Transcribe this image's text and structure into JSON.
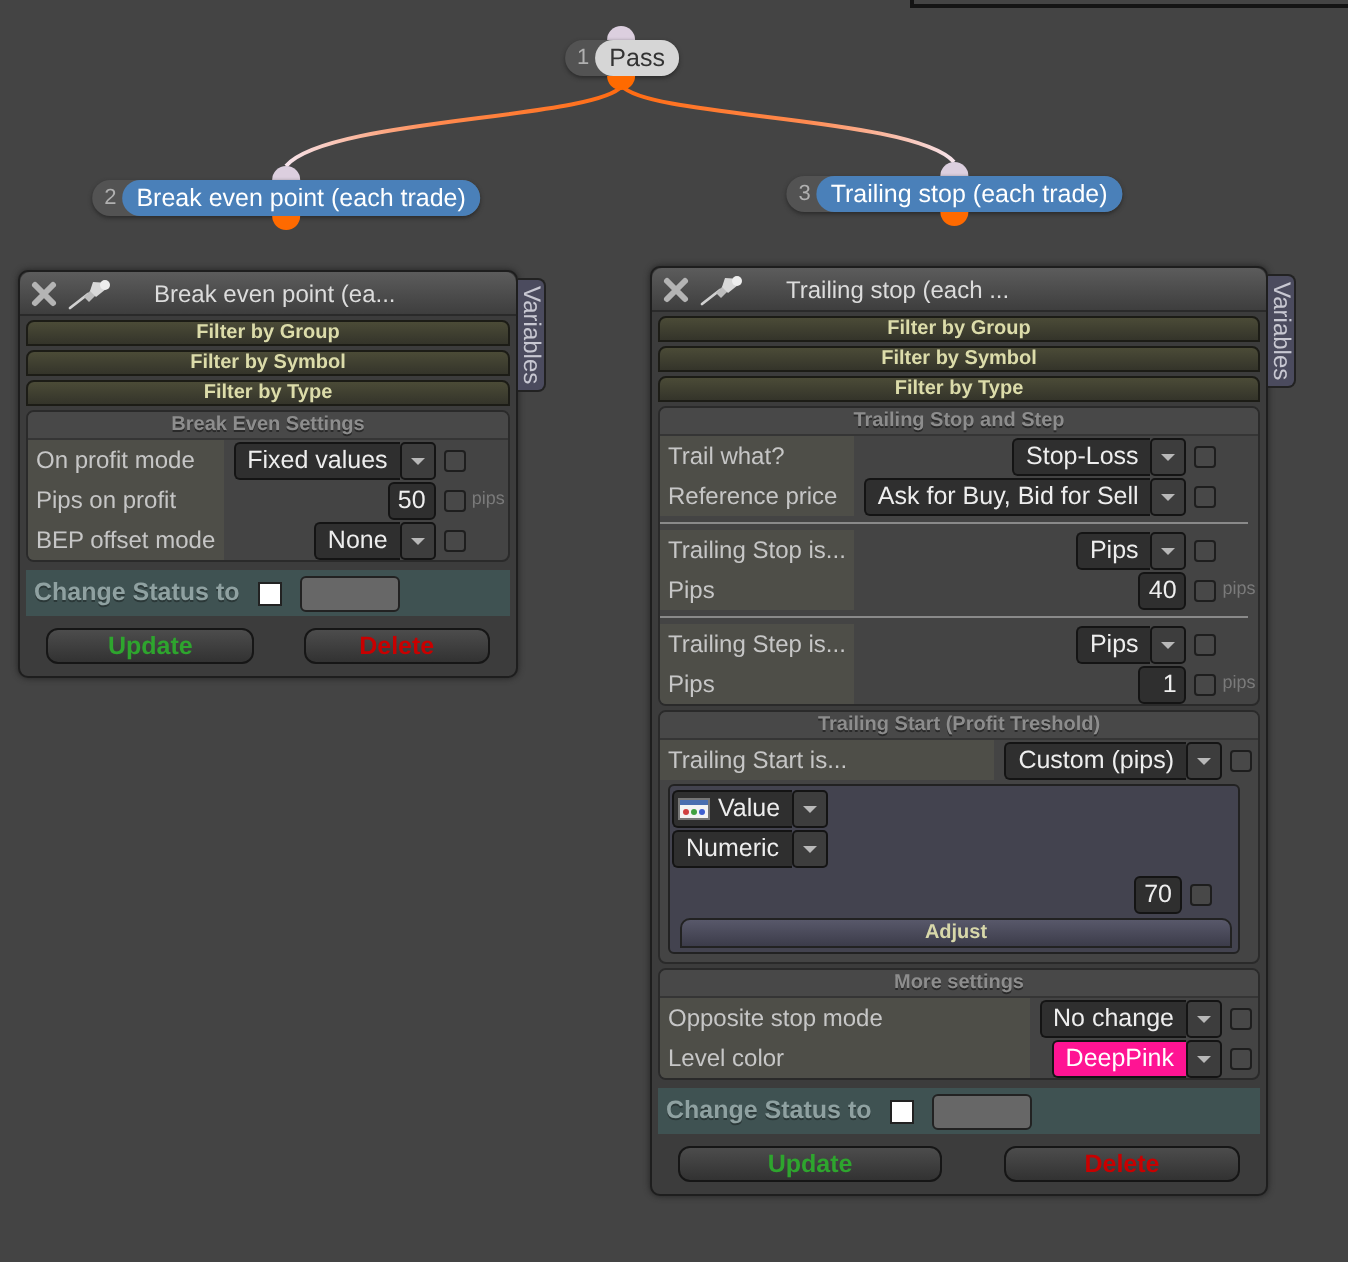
{
  "nodes": [
    {
      "number": "1",
      "label": "Pass",
      "kind": "pass",
      "children": [
        {
          "number": "2",
          "label": "Break even point (each trade)",
          "kind": "action"
        },
        {
          "number": "3",
          "label": "Trailing stop (each trade)",
          "kind": "action"
        }
      ]
    }
  ],
  "panels": [
    {
      "title": "Break even point (ea...",
      "side_tab": "Variables",
      "filters": [
        "Filter by Group",
        "Filter by Symbol",
        "Filter by Type"
      ],
      "sections": [
        {
          "title": "Break Even Settings",
          "groups": [
            [
              {
                "label": "On profit mode",
                "kind": "dropdown",
                "value": "Fixed values",
                "checked": false
              },
              {
                "label": "Pips on profit",
                "kind": "number",
                "value": "50",
                "unit": "pips",
                "checked": false
              },
              {
                "label": "BEP offset mode",
                "kind": "dropdown",
                "value": "None",
                "checked": false
              }
            ]
          ]
        }
      ],
      "status": {
        "label": "Change Status to",
        "checked": false
      },
      "buttons": [
        {
          "label": "Update",
          "kind": "update"
        },
        {
          "label": "Delete",
          "kind": "delete"
        }
      ]
    },
    {
      "title": "Trailing stop (each ...",
      "side_tab": "Variables",
      "filters": [
        "Filter by Group",
        "Filter by Symbol",
        "Filter by Type"
      ],
      "sections": [
        {
          "title": "Trailing Stop and Step",
          "groups": [
            [
              {
                "label": "Trail what?",
                "kind": "dropdown",
                "value": "Stop-Loss",
                "checked": false
              },
              {
                "label": "Reference price",
                "kind": "dropdown",
                "value": "Ask for Buy, Bid for Sell",
                "checked": false
              }
            ],
            [
              {
                "label": "Trailing Stop is...",
                "kind": "dropdown",
                "value": "Pips",
                "checked": false
              },
              {
                "label": "Pips",
                "kind": "number",
                "value": "40",
                "unit": "pips",
                "checked": false
              }
            ],
            [
              {
                "label": "Trailing Step is...",
                "kind": "dropdown",
                "value": "Pips",
                "checked": false
              },
              {
                "label": "Pips",
                "kind": "number",
                "value": "1",
                "unit": "pips",
                "checked": false
              }
            ]
          ]
        },
        {
          "title": "Trailing Start (Profit Treshold)",
          "groups": [
            [
              {
                "label": "Trailing Start is...",
                "kind": "dropdown",
                "value": "Custom (pips)",
                "checked": false
              },
              {
                "kind": "expression",
                "source": "Value",
                "type": "Numeric",
                "value": "70",
                "checked": false,
                "button": "Adjust"
              }
            ]
          ]
        },
        {
          "title": "More settings",
          "groups": [
            [
              {
                "label": "Opposite stop mode",
                "kind": "dropdown",
                "value": "No change",
                "checked": false
              },
              {
                "label": "Level color",
                "kind": "dropdown",
                "value": "DeepPink",
                "color": "#ff1493",
                "checked": false
              }
            ]
          ]
        }
      ],
      "status": {
        "label": "Change Status to",
        "checked": false
      },
      "buttons": [
        {
          "label": "Update",
          "kind": "update"
        },
        {
          "label": "Delete",
          "kind": "delete"
        }
      ]
    }
  ]
}
